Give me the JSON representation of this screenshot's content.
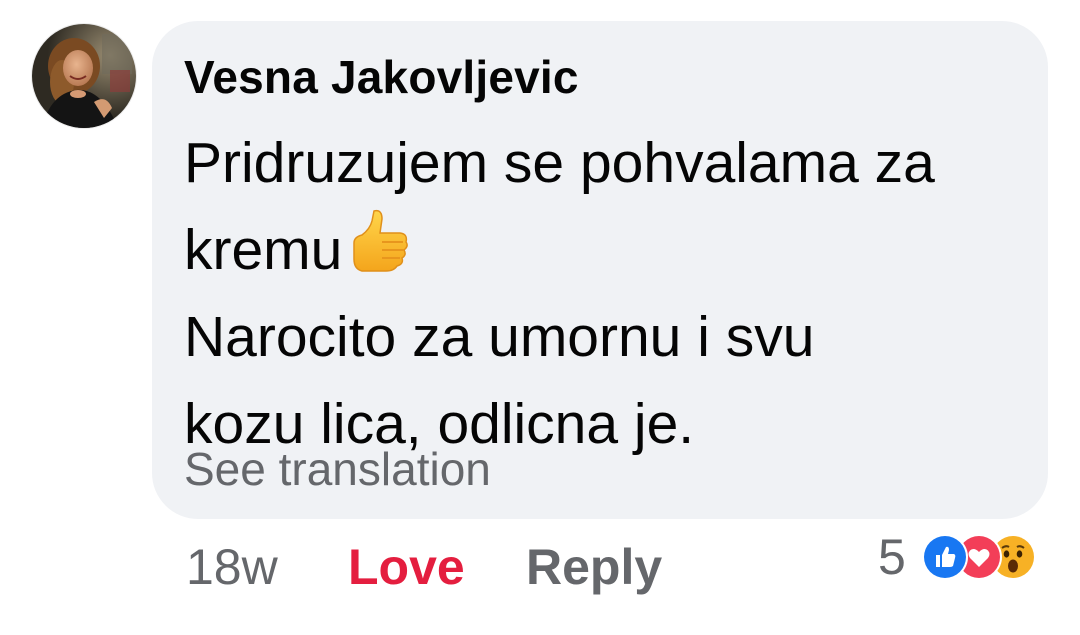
{
  "comment": {
    "author": "Vesna Jakovljevic",
    "text_lines": [
      "Pridruzujem se pohvalama za",
      "kremu",
      "Narocito za umornu i svu",
      "kozu lica, odlicna je."
    ],
    "inline_emoji": "thumbs-up-icon",
    "see_translation": "See translation"
  },
  "actions": {
    "timestamp": "18w",
    "love_label": "Love",
    "reply_label": "Reply"
  },
  "reactions": {
    "count": "5",
    "types": [
      "like-icon",
      "love-icon",
      "wow-icon"
    ]
  },
  "colors": {
    "bubble": "#f0f2f5",
    "text": "#050505",
    "secondary": "#65676b",
    "love_active": "#e41e3f",
    "like_blue": "#1877f2",
    "love_red": "#f33e58",
    "wow_yellow": "#f7b125"
  }
}
